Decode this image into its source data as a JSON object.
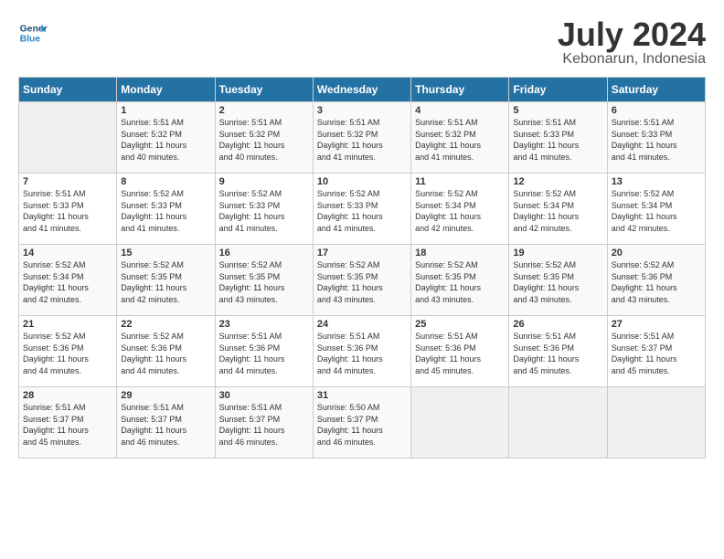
{
  "logo": {
    "line1": "General",
    "line2": "Blue"
  },
  "title": "July 2024",
  "location": "Kebonarun, Indonesia",
  "days_header": [
    "Sunday",
    "Monday",
    "Tuesday",
    "Wednesday",
    "Thursday",
    "Friday",
    "Saturday"
  ],
  "weeks": [
    [
      {
        "day": "",
        "info": ""
      },
      {
        "day": "1",
        "info": "Sunrise: 5:51 AM\nSunset: 5:32 PM\nDaylight: 11 hours\nand 40 minutes."
      },
      {
        "day": "2",
        "info": "Sunrise: 5:51 AM\nSunset: 5:32 PM\nDaylight: 11 hours\nand 40 minutes."
      },
      {
        "day": "3",
        "info": "Sunrise: 5:51 AM\nSunset: 5:32 PM\nDaylight: 11 hours\nand 41 minutes."
      },
      {
        "day": "4",
        "info": "Sunrise: 5:51 AM\nSunset: 5:32 PM\nDaylight: 11 hours\nand 41 minutes."
      },
      {
        "day": "5",
        "info": "Sunrise: 5:51 AM\nSunset: 5:33 PM\nDaylight: 11 hours\nand 41 minutes."
      },
      {
        "day": "6",
        "info": "Sunrise: 5:51 AM\nSunset: 5:33 PM\nDaylight: 11 hours\nand 41 minutes."
      }
    ],
    [
      {
        "day": "7",
        "info": "Sunrise: 5:51 AM\nSunset: 5:33 PM\nDaylight: 11 hours\nand 41 minutes."
      },
      {
        "day": "8",
        "info": "Sunrise: 5:52 AM\nSunset: 5:33 PM\nDaylight: 11 hours\nand 41 minutes."
      },
      {
        "day": "9",
        "info": "Sunrise: 5:52 AM\nSunset: 5:33 PM\nDaylight: 11 hours\nand 41 minutes."
      },
      {
        "day": "10",
        "info": "Sunrise: 5:52 AM\nSunset: 5:33 PM\nDaylight: 11 hours\nand 41 minutes."
      },
      {
        "day": "11",
        "info": "Sunrise: 5:52 AM\nSunset: 5:34 PM\nDaylight: 11 hours\nand 42 minutes."
      },
      {
        "day": "12",
        "info": "Sunrise: 5:52 AM\nSunset: 5:34 PM\nDaylight: 11 hours\nand 42 minutes."
      },
      {
        "day": "13",
        "info": "Sunrise: 5:52 AM\nSunset: 5:34 PM\nDaylight: 11 hours\nand 42 minutes."
      }
    ],
    [
      {
        "day": "14",
        "info": "Sunrise: 5:52 AM\nSunset: 5:34 PM\nDaylight: 11 hours\nand 42 minutes."
      },
      {
        "day": "15",
        "info": "Sunrise: 5:52 AM\nSunset: 5:35 PM\nDaylight: 11 hours\nand 42 minutes."
      },
      {
        "day": "16",
        "info": "Sunrise: 5:52 AM\nSunset: 5:35 PM\nDaylight: 11 hours\nand 43 minutes."
      },
      {
        "day": "17",
        "info": "Sunrise: 5:52 AM\nSunset: 5:35 PM\nDaylight: 11 hours\nand 43 minutes."
      },
      {
        "day": "18",
        "info": "Sunrise: 5:52 AM\nSunset: 5:35 PM\nDaylight: 11 hours\nand 43 minutes."
      },
      {
        "day": "19",
        "info": "Sunrise: 5:52 AM\nSunset: 5:35 PM\nDaylight: 11 hours\nand 43 minutes."
      },
      {
        "day": "20",
        "info": "Sunrise: 5:52 AM\nSunset: 5:36 PM\nDaylight: 11 hours\nand 43 minutes."
      }
    ],
    [
      {
        "day": "21",
        "info": "Sunrise: 5:52 AM\nSunset: 5:36 PM\nDaylight: 11 hours\nand 44 minutes."
      },
      {
        "day": "22",
        "info": "Sunrise: 5:52 AM\nSunset: 5:36 PM\nDaylight: 11 hours\nand 44 minutes."
      },
      {
        "day": "23",
        "info": "Sunrise: 5:51 AM\nSunset: 5:36 PM\nDaylight: 11 hours\nand 44 minutes."
      },
      {
        "day": "24",
        "info": "Sunrise: 5:51 AM\nSunset: 5:36 PM\nDaylight: 11 hours\nand 44 minutes."
      },
      {
        "day": "25",
        "info": "Sunrise: 5:51 AM\nSunset: 5:36 PM\nDaylight: 11 hours\nand 45 minutes."
      },
      {
        "day": "26",
        "info": "Sunrise: 5:51 AM\nSunset: 5:36 PM\nDaylight: 11 hours\nand 45 minutes."
      },
      {
        "day": "27",
        "info": "Sunrise: 5:51 AM\nSunset: 5:37 PM\nDaylight: 11 hours\nand 45 minutes."
      }
    ],
    [
      {
        "day": "28",
        "info": "Sunrise: 5:51 AM\nSunset: 5:37 PM\nDaylight: 11 hours\nand 45 minutes."
      },
      {
        "day": "29",
        "info": "Sunrise: 5:51 AM\nSunset: 5:37 PM\nDaylight: 11 hours\nand 46 minutes."
      },
      {
        "day": "30",
        "info": "Sunrise: 5:51 AM\nSunset: 5:37 PM\nDaylight: 11 hours\nand 46 minutes."
      },
      {
        "day": "31",
        "info": "Sunrise: 5:50 AM\nSunset: 5:37 PM\nDaylight: 11 hours\nand 46 minutes."
      },
      {
        "day": "",
        "info": ""
      },
      {
        "day": "",
        "info": ""
      },
      {
        "day": "",
        "info": ""
      }
    ]
  ]
}
